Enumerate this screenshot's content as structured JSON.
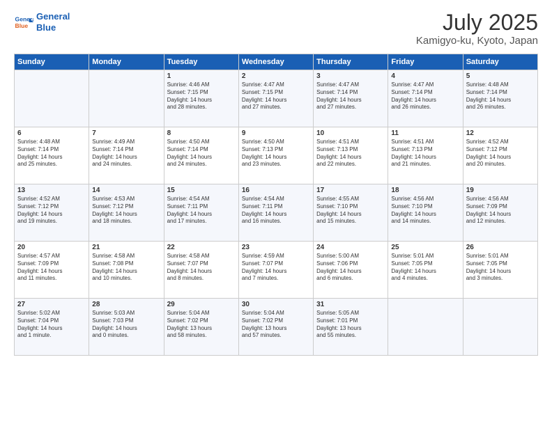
{
  "logo": {
    "line1": "General",
    "line2": "Blue"
  },
  "title": "July 2025",
  "location": "Kamigyo-ku, Kyoto, Japan",
  "weekdays": [
    "Sunday",
    "Monday",
    "Tuesday",
    "Wednesday",
    "Thursday",
    "Friday",
    "Saturday"
  ],
  "weeks": [
    [
      {
        "day": "",
        "detail": ""
      },
      {
        "day": "",
        "detail": ""
      },
      {
        "day": "1",
        "detail": "Sunrise: 4:46 AM\nSunset: 7:15 PM\nDaylight: 14 hours\nand 28 minutes."
      },
      {
        "day": "2",
        "detail": "Sunrise: 4:47 AM\nSunset: 7:15 PM\nDaylight: 14 hours\nand 27 minutes."
      },
      {
        "day": "3",
        "detail": "Sunrise: 4:47 AM\nSunset: 7:14 PM\nDaylight: 14 hours\nand 27 minutes."
      },
      {
        "day": "4",
        "detail": "Sunrise: 4:47 AM\nSunset: 7:14 PM\nDaylight: 14 hours\nand 26 minutes."
      },
      {
        "day": "5",
        "detail": "Sunrise: 4:48 AM\nSunset: 7:14 PM\nDaylight: 14 hours\nand 26 minutes."
      }
    ],
    [
      {
        "day": "6",
        "detail": "Sunrise: 4:48 AM\nSunset: 7:14 PM\nDaylight: 14 hours\nand 25 minutes."
      },
      {
        "day": "7",
        "detail": "Sunrise: 4:49 AM\nSunset: 7:14 PM\nDaylight: 14 hours\nand 24 minutes."
      },
      {
        "day": "8",
        "detail": "Sunrise: 4:50 AM\nSunset: 7:14 PM\nDaylight: 14 hours\nand 24 minutes."
      },
      {
        "day": "9",
        "detail": "Sunrise: 4:50 AM\nSunset: 7:13 PM\nDaylight: 14 hours\nand 23 minutes."
      },
      {
        "day": "10",
        "detail": "Sunrise: 4:51 AM\nSunset: 7:13 PM\nDaylight: 14 hours\nand 22 minutes."
      },
      {
        "day": "11",
        "detail": "Sunrise: 4:51 AM\nSunset: 7:13 PM\nDaylight: 14 hours\nand 21 minutes."
      },
      {
        "day": "12",
        "detail": "Sunrise: 4:52 AM\nSunset: 7:12 PM\nDaylight: 14 hours\nand 20 minutes."
      }
    ],
    [
      {
        "day": "13",
        "detail": "Sunrise: 4:52 AM\nSunset: 7:12 PM\nDaylight: 14 hours\nand 19 minutes."
      },
      {
        "day": "14",
        "detail": "Sunrise: 4:53 AM\nSunset: 7:12 PM\nDaylight: 14 hours\nand 18 minutes."
      },
      {
        "day": "15",
        "detail": "Sunrise: 4:54 AM\nSunset: 7:11 PM\nDaylight: 14 hours\nand 17 minutes."
      },
      {
        "day": "16",
        "detail": "Sunrise: 4:54 AM\nSunset: 7:11 PM\nDaylight: 14 hours\nand 16 minutes."
      },
      {
        "day": "17",
        "detail": "Sunrise: 4:55 AM\nSunset: 7:10 PM\nDaylight: 14 hours\nand 15 minutes."
      },
      {
        "day": "18",
        "detail": "Sunrise: 4:56 AM\nSunset: 7:10 PM\nDaylight: 14 hours\nand 14 minutes."
      },
      {
        "day": "19",
        "detail": "Sunrise: 4:56 AM\nSunset: 7:09 PM\nDaylight: 14 hours\nand 12 minutes."
      }
    ],
    [
      {
        "day": "20",
        "detail": "Sunrise: 4:57 AM\nSunset: 7:09 PM\nDaylight: 14 hours\nand 11 minutes."
      },
      {
        "day": "21",
        "detail": "Sunrise: 4:58 AM\nSunset: 7:08 PM\nDaylight: 14 hours\nand 10 minutes."
      },
      {
        "day": "22",
        "detail": "Sunrise: 4:58 AM\nSunset: 7:07 PM\nDaylight: 14 hours\nand 8 minutes."
      },
      {
        "day": "23",
        "detail": "Sunrise: 4:59 AM\nSunset: 7:07 PM\nDaylight: 14 hours\nand 7 minutes."
      },
      {
        "day": "24",
        "detail": "Sunrise: 5:00 AM\nSunset: 7:06 PM\nDaylight: 14 hours\nand 6 minutes."
      },
      {
        "day": "25",
        "detail": "Sunrise: 5:01 AM\nSunset: 7:05 PM\nDaylight: 14 hours\nand 4 minutes."
      },
      {
        "day": "26",
        "detail": "Sunrise: 5:01 AM\nSunset: 7:05 PM\nDaylight: 14 hours\nand 3 minutes."
      }
    ],
    [
      {
        "day": "27",
        "detail": "Sunrise: 5:02 AM\nSunset: 7:04 PM\nDaylight: 14 hours\nand 1 minute."
      },
      {
        "day": "28",
        "detail": "Sunrise: 5:03 AM\nSunset: 7:03 PM\nDaylight: 14 hours\nand 0 minutes."
      },
      {
        "day": "29",
        "detail": "Sunrise: 5:04 AM\nSunset: 7:02 PM\nDaylight: 13 hours\nand 58 minutes."
      },
      {
        "day": "30",
        "detail": "Sunrise: 5:04 AM\nSunset: 7:02 PM\nDaylight: 13 hours\nand 57 minutes."
      },
      {
        "day": "31",
        "detail": "Sunrise: 5:05 AM\nSunset: 7:01 PM\nDaylight: 13 hours\nand 55 minutes."
      },
      {
        "day": "",
        "detail": ""
      },
      {
        "day": "",
        "detail": ""
      }
    ]
  ]
}
